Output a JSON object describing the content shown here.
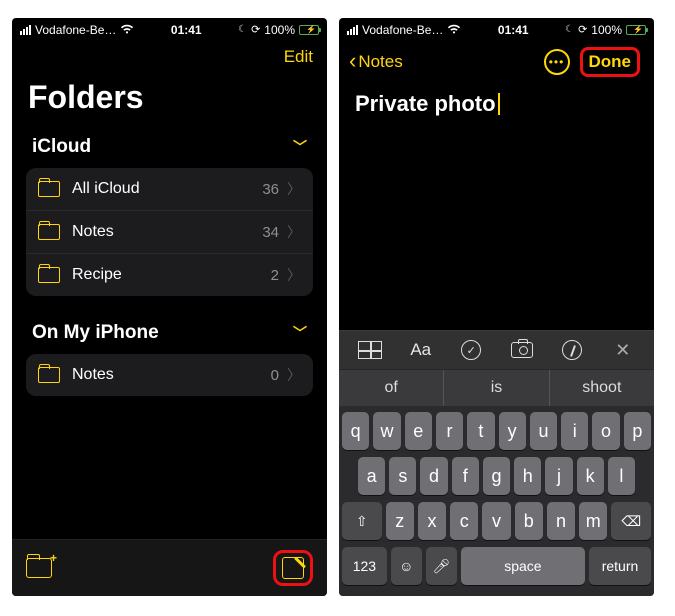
{
  "status": {
    "carrier": "Vodafone-Be…",
    "time": "01:41",
    "battery_text": "100%"
  },
  "left": {
    "edit": "Edit",
    "title": "Folders",
    "sections": [
      {
        "name": "iCloud",
        "folders": [
          {
            "label": "All iCloud",
            "count": "36"
          },
          {
            "label": "Notes",
            "count": "34"
          },
          {
            "label": "Recipe",
            "count": "2"
          }
        ]
      },
      {
        "name": "On My iPhone",
        "folders": [
          {
            "label": "Notes",
            "count": "0"
          }
        ]
      }
    ]
  },
  "right": {
    "back_label": "Notes",
    "done": "Done",
    "note_title": "Private photo",
    "suggestions": [
      "of",
      "is",
      "shoot"
    ],
    "keyboard": {
      "row1": [
        "q",
        "w",
        "e",
        "r",
        "t",
        "y",
        "u",
        "i",
        "o",
        "p"
      ],
      "row2": [
        "a",
        "s",
        "d",
        "f",
        "g",
        "h",
        "j",
        "k",
        "l"
      ],
      "row3_mid": [
        "z",
        "x",
        "c",
        "v",
        "b",
        "n",
        "m"
      ],
      "num_key": "123",
      "space": "space",
      "return": "return"
    },
    "toolbar": {
      "aa": "Aa"
    }
  }
}
